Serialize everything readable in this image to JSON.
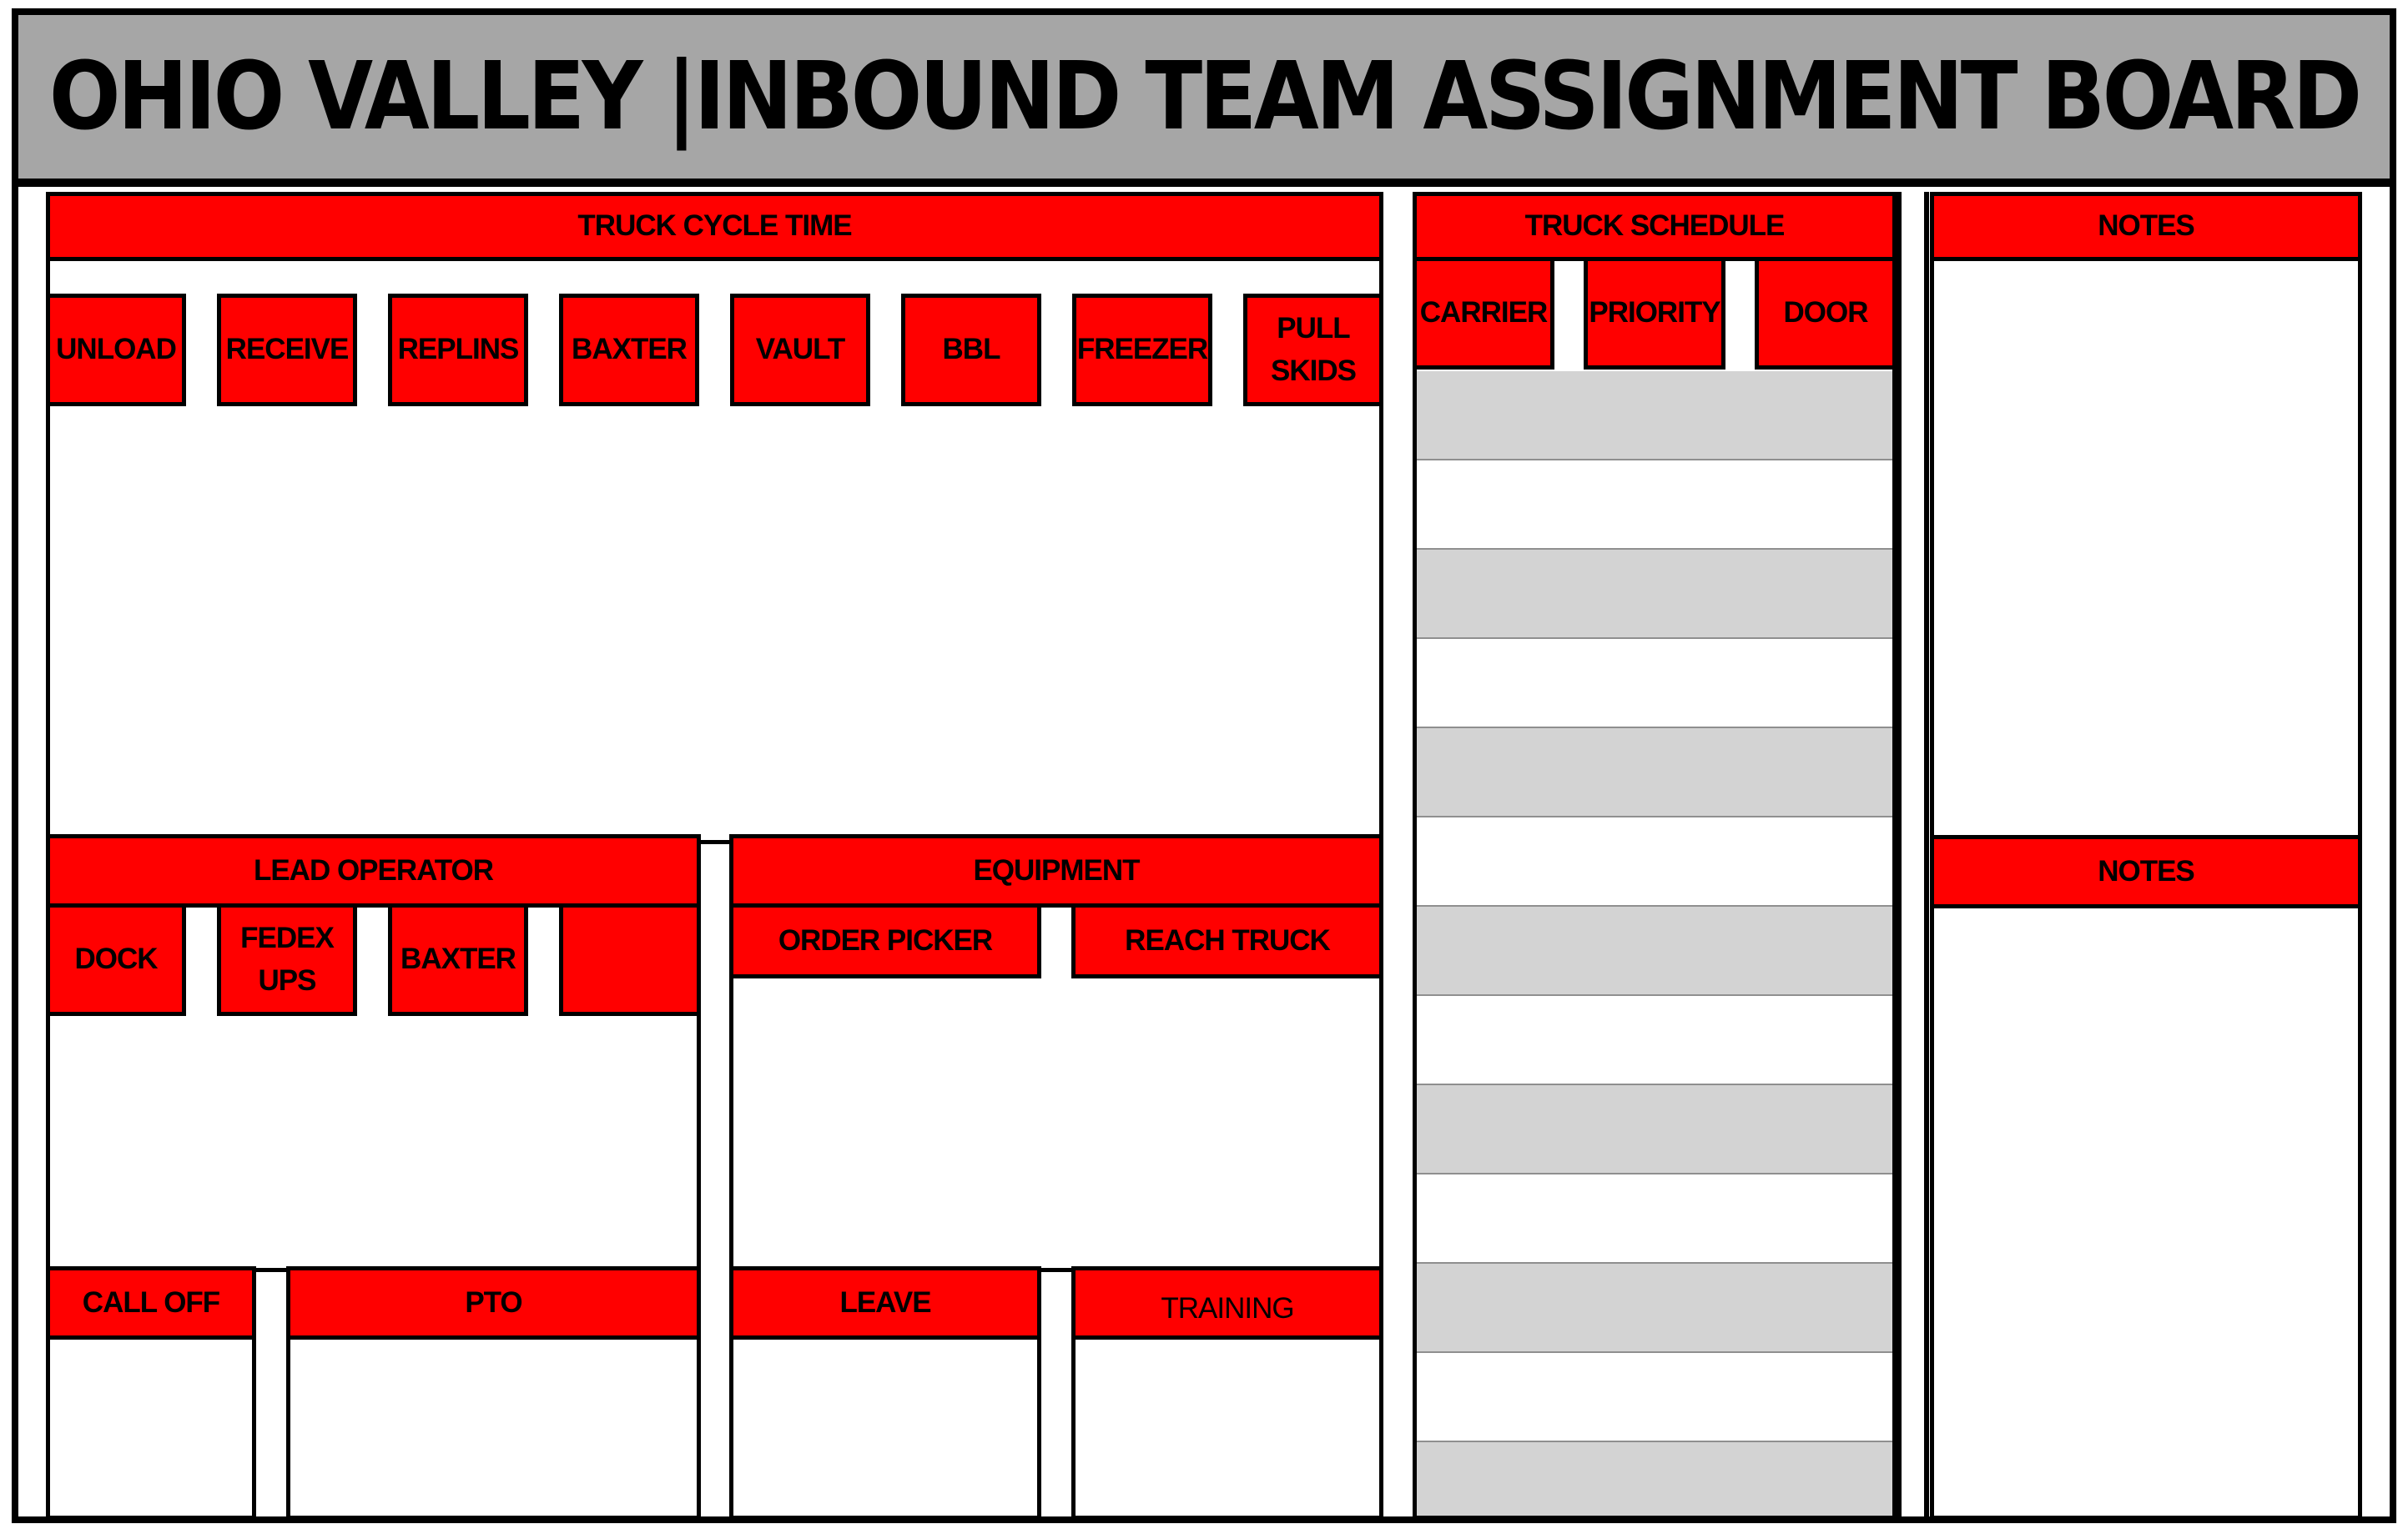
{
  "title": "OHIO VALLEY |INBOUND TEAM ASSIGNMENT BOARD",
  "colors": {
    "header_red": "#ff0000",
    "title_gray": "#a6a6a6",
    "row_gray": "#d3d3d3",
    "border": "#000000"
  },
  "truck_cycle_time": {
    "header": "TRUCK CYCLE TIME",
    "columns": [
      "UNLOAD",
      "RECEIVE",
      "REPLINS",
      "BAXTER",
      "VAULT",
      "BBL",
      "FREEZER",
      "PULL\nSKIDS"
    ]
  },
  "lead_operator": {
    "header": "LEAD OPERATOR",
    "columns": [
      "DOCK",
      "FEDEX\nUPS",
      "BAXTER",
      ""
    ]
  },
  "equipment": {
    "header": "EQUIPMENT",
    "columns": [
      "ORDER PICKER",
      "REACH TRUCK"
    ]
  },
  "absence": {
    "call_off": "CALL OFF",
    "pto": "PTO",
    "leave": "LEAVE",
    "training": "TRAINING"
  },
  "truck_schedule": {
    "header": "TRUCK SCHEDULE",
    "columns": [
      "CARRIER",
      "PRIORITY",
      "DOOR"
    ],
    "row_count": 13
  },
  "notes": {
    "top_header": "NOTES",
    "bottom_header": "NOTES"
  }
}
